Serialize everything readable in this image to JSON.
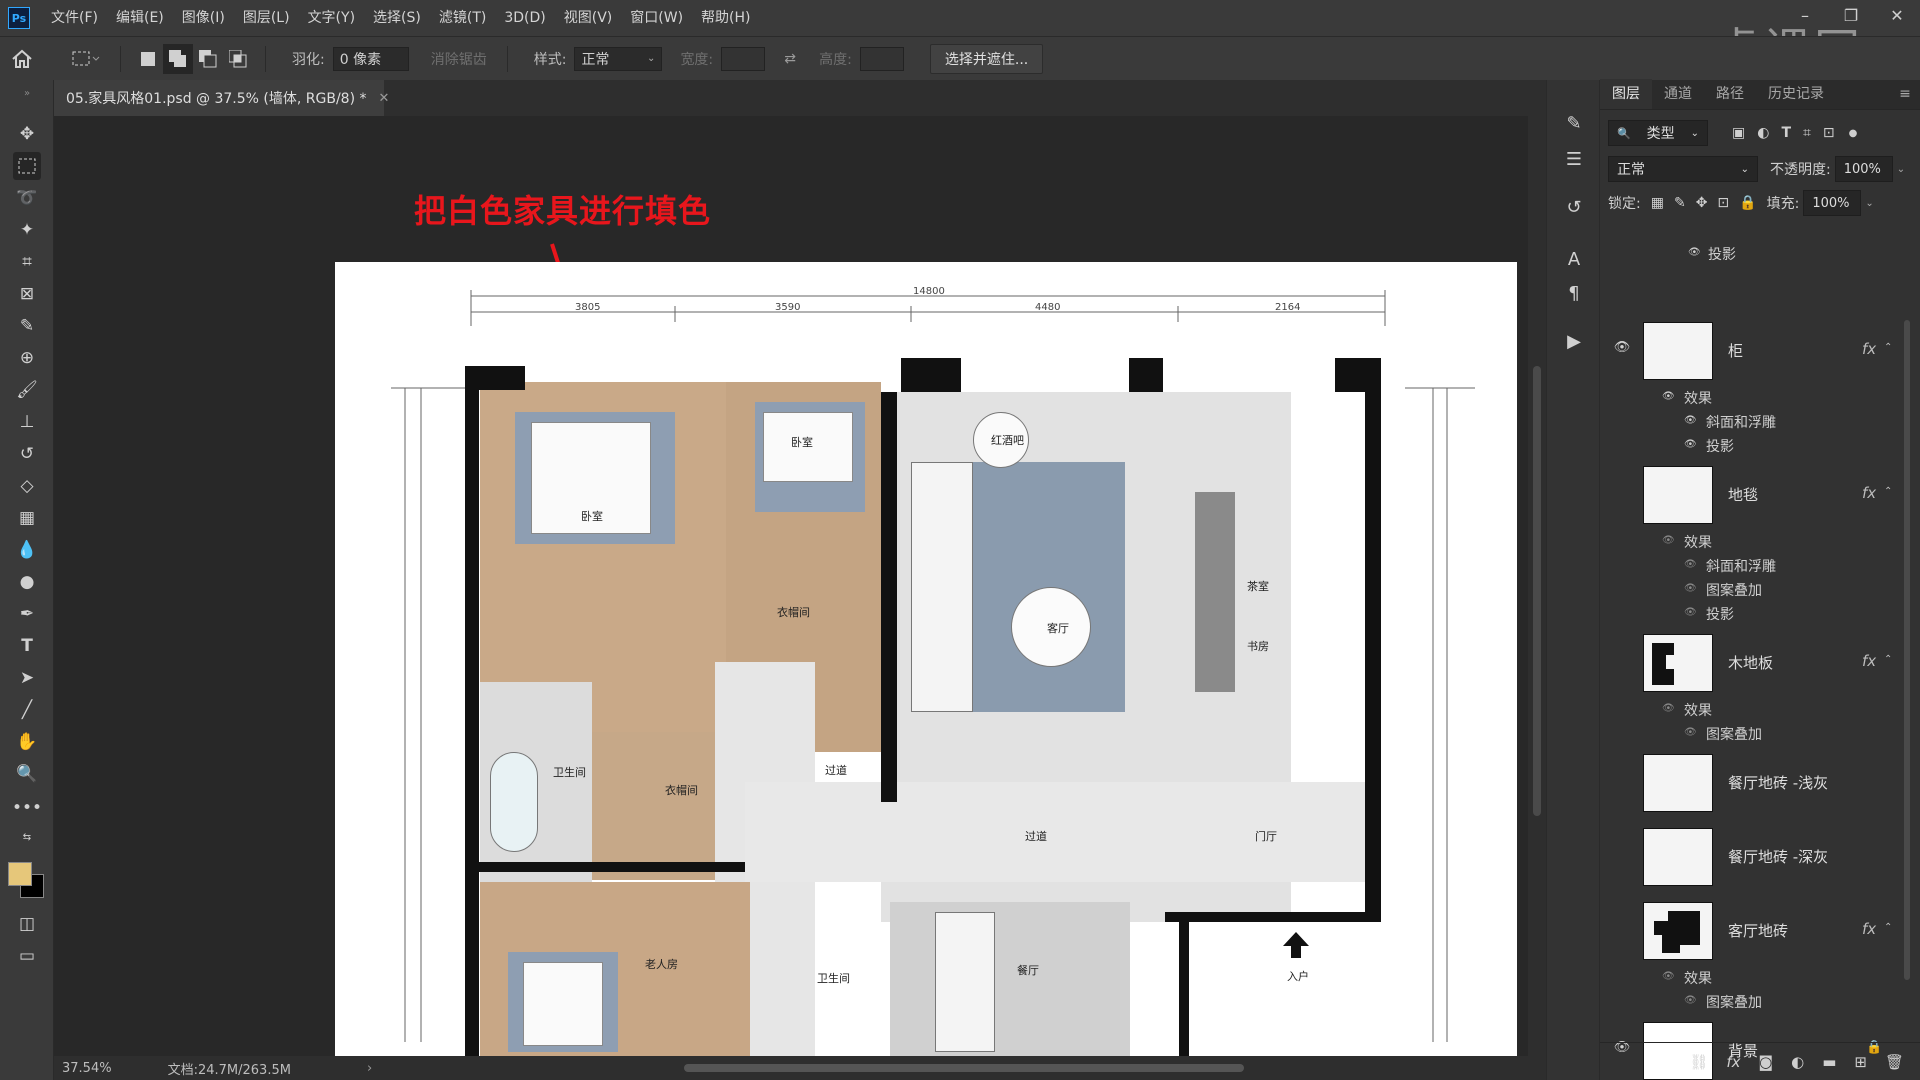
{
  "app": {
    "logo": "Ps"
  },
  "menu": [
    "文件(F)",
    "编辑(E)",
    "图像(I)",
    "图层(L)",
    "文字(Y)",
    "选择(S)",
    "滤镜(T)",
    "3D(D)",
    "视图(V)",
    "窗口(W)",
    "帮助(H)"
  ],
  "watermark": "虎课网",
  "window_controls": {
    "minimize": "–",
    "restore": "❐",
    "close": "✕"
  },
  "options": {
    "feather_label": "羽化:",
    "feather_value": "0 像素",
    "antialias_label": "消除锯齿",
    "style_label": "样式:",
    "style_value": "正常",
    "width_label": "宽度:",
    "height_label": "高度:",
    "select_mask_button": "选择并遮住..."
  },
  "document": {
    "tab_title": "05.家具风格01.psd @ 37.5% (墙体, RGB/8) *",
    "annotation": "把白色家具进行填色"
  },
  "floorplan": {
    "dimensions": {
      "total": "14800",
      "d1": "3805",
      "d2": "3590",
      "d3": "4480",
      "d4": "2164"
    },
    "rooms": {
      "bedroom": "卧室",
      "second_bedroom": "卧室",
      "closet": "衣帽间",
      "closet2": "衣帽间",
      "living": "客厅",
      "wine": "红酒吧",
      "study": "书房",
      "study_desk": "茶室",
      "bathroom": "卫生间",
      "bathroom2": "卫生间",
      "corridor": "过道",
      "corridor2": "过道",
      "foyer": "门厅",
      "elder": "老人房",
      "dining": "餐厅",
      "entrance": "入户"
    }
  },
  "status": {
    "zoom": "37.54%",
    "doc_size": "文档:24.7M/263.5M"
  },
  "layers_panel": {
    "tabs": [
      "图层",
      "通道",
      "路径",
      "历史记录"
    ],
    "filter_kind": "类型",
    "blend_mode": "正常",
    "opacity_label": "不透明度:",
    "opacity_value": "100%",
    "lock_label": "锁定:",
    "fill_label": "填充:",
    "fill_value": "100%",
    "top_effect": "投影",
    "layers": [
      {
        "name": "柜",
        "visible": true,
        "fx": "fx",
        "effects_title": "效果",
        "effects": [
          "斜面和浮雕",
          "投影"
        ]
      },
      {
        "name": "地毯",
        "visible": false,
        "fx": "fx",
        "effects_title": "效果",
        "effects": [
          "斜面和浮雕",
          "图案叠加",
          "投影"
        ]
      },
      {
        "name": "木地板",
        "visible": false,
        "fx": "fx",
        "effects_title": "效果",
        "effects": [
          "图案叠加"
        ]
      },
      {
        "name": "餐厅地砖 -浅灰",
        "visible": false
      },
      {
        "name": "餐厅地砖 -深灰",
        "visible": false
      },
      {
        "name": "客厅地砖",
        "visible": false,
        "fx": "fx",
        "effects_title": "效果",
        "effects": [
          "图案叠加"
        ]
      },
      {
        "name": "背景",
        "visible": true,
        "locked": true
      }
    ]
  },
  "colors": {
    "accent_red": "#e8161c",
    "foreground": "#e6c77a",
    "background": "#000000"
  }
}
